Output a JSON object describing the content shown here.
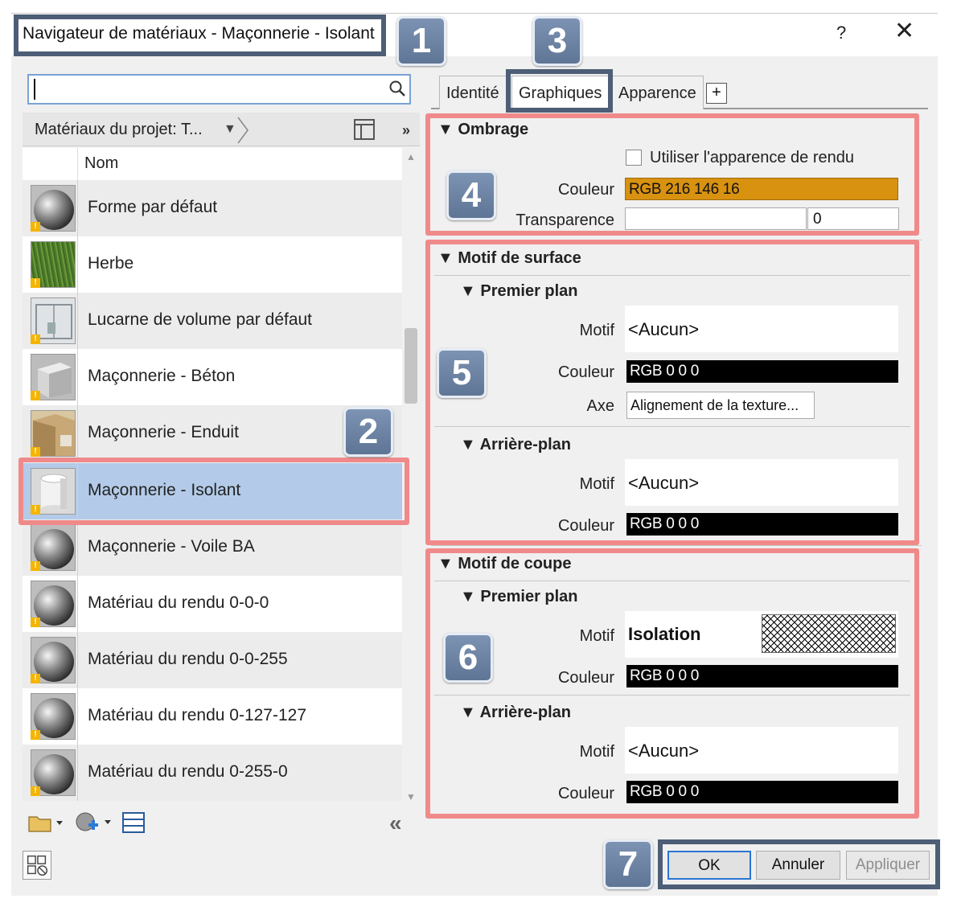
{
  "window": {
    "title": "Navigateur de matériaux - Maçonnerie - Isolant",
    "help": "?",
    "close": "✕"
  },
  "callouts": [
    "1",
    "2",
    "3",
    "4",
    "5",
    "6",
    "7"
  ],
  "library": {
    "search_value": "",
    "project_label": "Matériaux du projet: T...",
    "more": "»",
    "column_header": "Nom",
    "collapse": "«"
  },
  "materials": [
    {
      "name": "Forme par défaut",
      "thumb": "sphere-gray"
    },
    {
      "name": "Herbe",
      "thumb": "grass"
    },
    {
      "name": "Lucarne de volume par défaut",
      "thumb": "skylight"
    },
    {
      "name": "Maçonnerie - Béton",
      "thumb": "concrete"
    },
    {
      "name": "Maçonnerie - Enduit",
      "thumb": "plaster"
    },
    {
      "name": "Maçonnerie - Isolant",
      "thumb": "cylinder-white",
      "selected": true
    },
    {
      "name": "Maçonnerie - Voile BA",
      "thumb": "sphere-gray"
    },
    {
      "name": "Matériau du rendu 0-0-0",
      "thumb": "sphere-gray"
    },
    {
      "name": "Matériau du rendu 0-0-255",
      "thumb": "sphere-gray"
    },
    {
      "name": "Matériau du rendu 0-127-127",
      "thumb": "sphere-gray"
    },
    {
      "name": "Matériau du rendu 0-255-0",
      "thumb": "sphere-gray"
    }
  ],
  "tabs": [
    {
      "label": "Identité"
    },
    {
      "label": "Graphiques",
      "active": true
    },
    {
      "label": "Apparence"
    }
  ],
  "tab_add": "+",
  "shading": {
    "title": "Ombrage",
    "use_render_label": "Utiliser l'apparence de rendu",
    "use_render_checked": false,
    "color_label": "Couleur",
    "color_value": "RGB 216 146 16",
    "color_hex": "#d89210",
    "transparency_label": "Transparence",
    "transparency_value": "0"
  },
  "surface_pattern": {
    "title": "Motif de surface",
    "foreground": {
      "title": "Premier plan",
      "pattern_label": "Motif",
      "pattern_value": "<Aucun>",
      "color_label": "Couleur",
      "color_value": "RGB 0 0 0",
      "alignment_label": "Axe",
      "alignment_button": "Alignement de la texture..."
    },
    "background": {
      "title": "Arrière-plan",
      "pattern_label": "Motif",
      "pattern_value": "<Aucun>",
      "color_label": "Couleur",
      "color_value": "RGB 0 0 0"
    }
  },
  "cut_pattern": {
    "title": "Motif de coupe",
    "foreground": {
      "title": "Premier plan",
      "pattern_label": "Motif",
      "pattern_value": "Isolation",
      "color_label": "Couleur",
      "color_value": "RGB 0 0 0"
    },
    "background": {
      "title": "Arrière-plan",
      "pattern_label": "Motif",
      "pattern_value": "<Aucun>",
      "color_label": "Couleur",
      "color_value": "RGB 0 0 0"
    }
  },
  "buttons": {
    "ok": "OK",
    "cancel": "Annuler",
    "apply": "Appliquer",
    "apply_enabled": false
  },
  "colors": {
    "callout_dark": "#4d5e76",
    "callout_red": "#f08a8a",
    "badge": "#6f85a6",
    "selection": "#b3cbe8"
  }
}
